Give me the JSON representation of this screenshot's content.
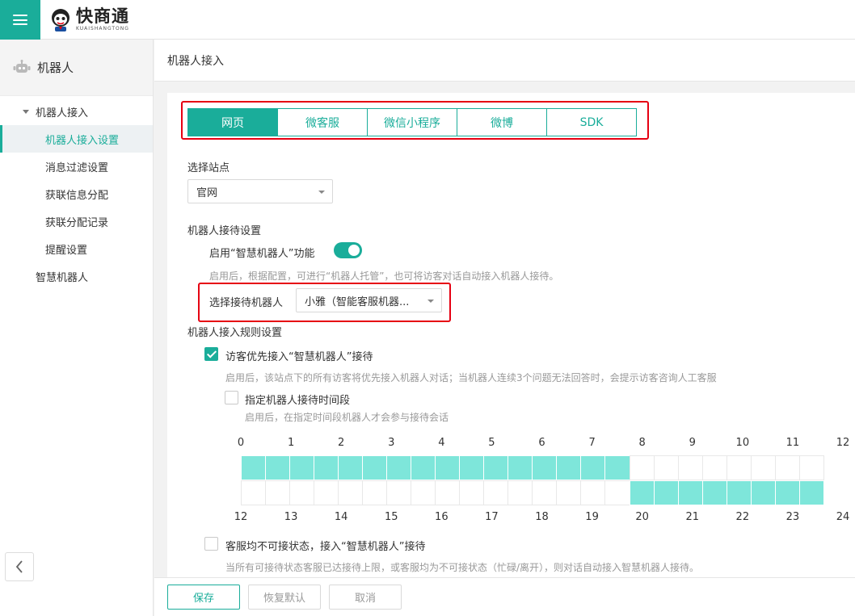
{
  "brand": {
    "name_cn": "快商通",
    "name_en": "KUAISHANGTONG"
  },
  "sidebar": {
    "title": "机器人",
    "group": "机器人接入",
    "items": [
      {
        "label": "机器人接入设置",
        "active": true
      },
      {
        "label": "消息过滤设置",
        "active": false
      },
      {
        "label": "获联信息分配",
        "active": false
      },
      {
        "label": "获联分配记录",
        "active": false
      },
      {
        "label": "提醒设置",
        "active": false
      }
    ],
    "extra": "智慧机器人"
  },
  "breadcrumb": "机器人接入",
  "tabs": [
    "网页",
    "微客服",
    "微信小程序",
    "微博",
    "SDK"
  ],
  "active_tab": 0,
  "site": {
    "label": "选择站点",
    "value": "官网"
  },
  "reception": {
    "title": "机器人接待设置",
    "enable_label": "启用“智慧机器人”功能",
    "enabled": true,
    "enable_hint": "启用后，根据配置，可进行“机器人托管”，也可将访客对话自动接入机器人接待。",
    "robot_label": "选择接待机器人",
    "robot_value": "小雅（智能客服机器..."
  },
  "rules": {
    "title": "机器人接入规则设置",
    "priority_label": "访客优先接入“智慧机器人”接待",
    "priority_checked": true,
    "priority_hint": "启用后，该站点下的所有访客将优先接入机器人对话；当机器人连续3个问题无法回答时，会提示访客咨询人工客服",
    "period_label": "指定机器人接待时间段",
    "period_checked": false,
    "period_hint": "启用后，在指定时间段机器人才会参与接待会话",
    "unavailable_label": "客服均不可接状态，接入“智慧机器人”接待",
    "unavailable_checked": false,
    "unavailable_hint": "当所有可接待状态客服已达接待上限，或客服均为不可接状态（忙碌/离开），则对话自动接入智慧机器人接待。"
  },
  "schedule": {
    "top_hours": [
      "0",
      "1",
      "2",
      "3",
      "4",
      "5",
      "6",
      "7",
      "8",
      "9",
      "10",
      "11",
      "12"
    ],
    "bottom_hours": [
      "12",
      "13",
      "14",
      "15",
      "16",
      "17",
      "18",
      "19",
      "20",
      "21",
      "22",
      "23",
      "24"
    ],
    "top_row": [
      1,
      1,
      1,
      1,
      1,
      1,
      1,
      1,
      1,
      1,
      1,
      1,
      1,
      1,
      1,
      1,
      0,
      0,
      0,
      0,
      0,
      0,
      0,
      0
    ],
    "bottom_row": [
      0,
      0,
      0,
      0,
      0,
      0,
      0,
      0,
      0,
      0,
      0,
      0,
      0,
      0,
      0,
      0,
      1,
      1,
      1,
      1,
      1,
      1,
      1,
      1
    ]
  },
  "buttons": {
    "save": "保存",
    "reset": "恢复默认",
    "cancel": "取消"
  },
  "colors": {
    "accent": "#1aad9a",
    "cell_on": "#7ee6da",
    "highlight": "#e60012"
  }
}
